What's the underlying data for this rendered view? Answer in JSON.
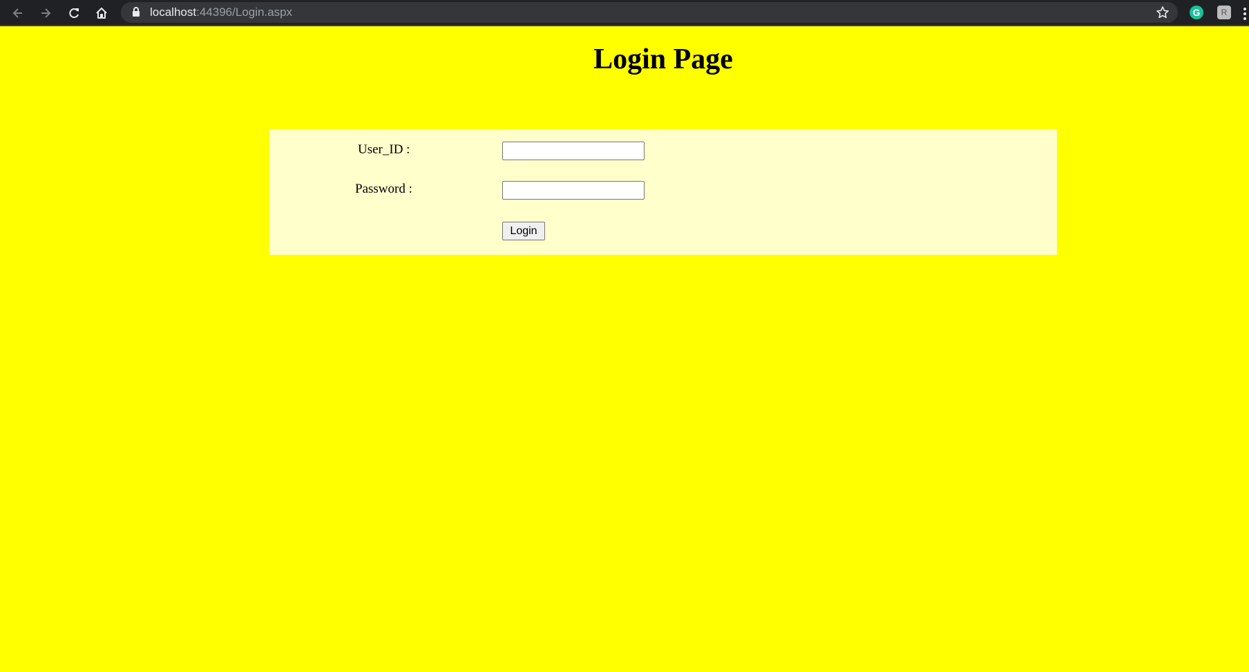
{
  "browser": {
    "url_host": "localhost",
    "url_path": ":44396/Login.aspx",
    "extension_grammarly_letter": "G",
    "extension_other_letter": "R"
  },
  "page": {
    "title": "Login Page",
    "background_color": "#ffff00",
    "panel_color": "#ffffcc"
  },
  "form": {
    "user_id_label": "User_ID :",
    "user_id_value": "",
    "password_label": "Password :",
    "password_value": "",
    "login_button_label": "Login"
  },
  "icons": {
    "back": "back-arrow-icon",
    "forward": "forward-arrow-icon",
    "reload": "reload-icon",
    "home": "home-icon",
    "lock": "lock-icon",
    "bookmark": "star-icon",
    "menu": "more-menu-icon"
  }
}
